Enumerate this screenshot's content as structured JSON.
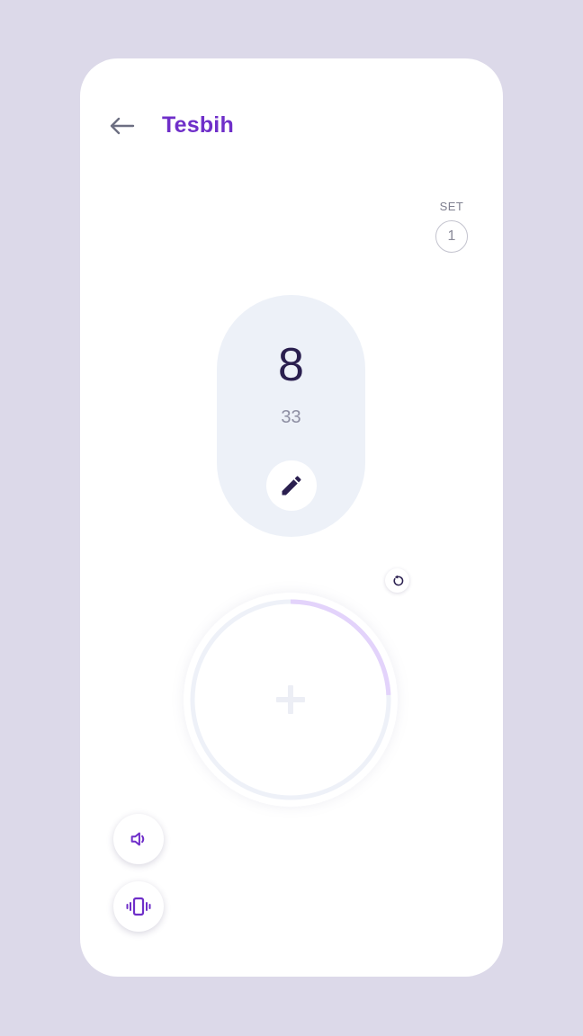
{
  "header": {
    "title": "Tesbih",
    "back_icon": "arrow-left-icon"
  },
  "set": {
    "label": "SET",
    "value": "1"
  },
  "counter": {
    "count": "8",
    "target": "33",
    "progress_fraction": 0.2424,
    "edit_icon": "pencil-icon",
    "reset_icon": "reset-icon",
    "tap_icon": "plus-icon"
  },
  "controls": {
    "sound_icon": "speaker-icon",
    "vibrate_icon": "vibrate-icon"
  },
  "colors": {
    "background": "#dcd9e9",
    "accent": "#6f2fc9",
    "progress": "#e3d3fb",
    "track": "#eef1f8",
    "count_text": "#2a1f4f"
  }
}
